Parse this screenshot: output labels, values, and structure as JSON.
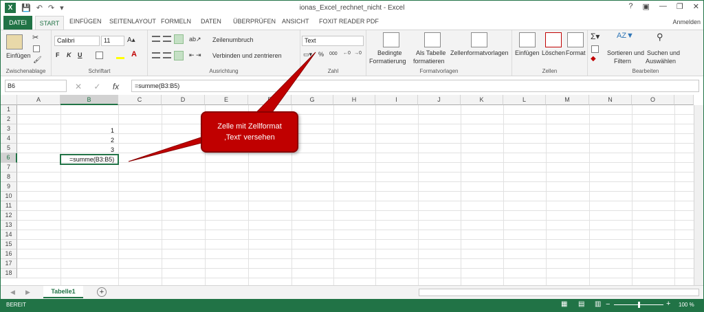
{
  "window": {
    "title": "ionas_Excel_rechnet_nicht - Excel",
    "signin": "Anmelden",
    "controls": [
      "?",
      "▣",
      "—",
      "❐",
      "✕"
    ]
  },
  "tabs": {
    "file": "DATEI",
    "items": [
      "START",
      "EINFÜGEN",
      "SEITENLAYOUT",
      "FORMELN",
      "DATEN",
      "ÜBERPRÜFEN",
      "ANSICHT",
      "FOXIT READER PDF"
    ]
  },
  "ribbon": {
    "clipboard": {
      "paste": "Einfügen",
      "label": "Zwischenablage"
    },
    "font": {
      "name": "Calibri",
      "size": "11",
      "bold": "F",
      "italic": "K",
      "underline": "U",
      "label": "Schriftart"
    },
    "alignment": {
      "wrap": "Zeilenumbruch",
      "merge": "Verbinden und zentrieren",
      "label": "Ausrichtung"
    },
    "number": {
      "format": "Text",
      "percent": "%",
      "thousands": "000",
      "label": "Zahl"
    },
    "styles": {
      "conditional1": "Bedingte",
      "conditional2": "Formatierung",
      "table1": "Als Tabelle",
      "table2": "formatieren",
      "cellstyles": "Zellenformatvorlagen",
      "label": "Formatvorlagen"
    },
    "cells": {
      "insert": "Einfügen",
      "delete": "Löschen",
      "format": "Format",
      "label": "Zellen"
    },
    "editing": {
      "sort1": "Sortieren und",
      "sort2": "Filtern",
      "find1": "Suchen und",
      "find2": "Auswählen",
      "label": "Bearbeiten"
    }
  },
  "formula_bar": {
    "name_box": "B6",
    "fx": "fx",
    "formula": "=summe(B3:B5)"
  },
  "grid": {
    "columns": [
      "A",
      "B",
      "C",
      "D",
      "E",
      "F",
      "G",
      "H",
      "I",
      "J",
      "K",
      "L",
      "M",
      "N",
      "O"
    ],
    "rows": [
      "1",
      "2",
      "3",
      "4",
      "5",
      "6",
      "7",
      "8",
      "9",
      "10",
      "11",
      "12",
      "13",
      "14",
      "15",
      "16",
      "17",
      "18"
    ],
    "cells": {
      "B3": "1",
      "B4": "2",
      "B5": "3",
      "B6": "=summe(B3:B5)"
    }
  },
  "callout": {
    "line1": "Zelle mit Zellformat",
    "line2": "‚Text‘ versehen"
  },
  "sheet": {
    "name": "Tabelle1",
    "add": "+"
  },
  "status": {
    "mode": "BEREIT",
    "zoom": "100 %"
  },
  "colors": {
    "accent": "#217346",
    "callout": "#c00000"
  }
}
